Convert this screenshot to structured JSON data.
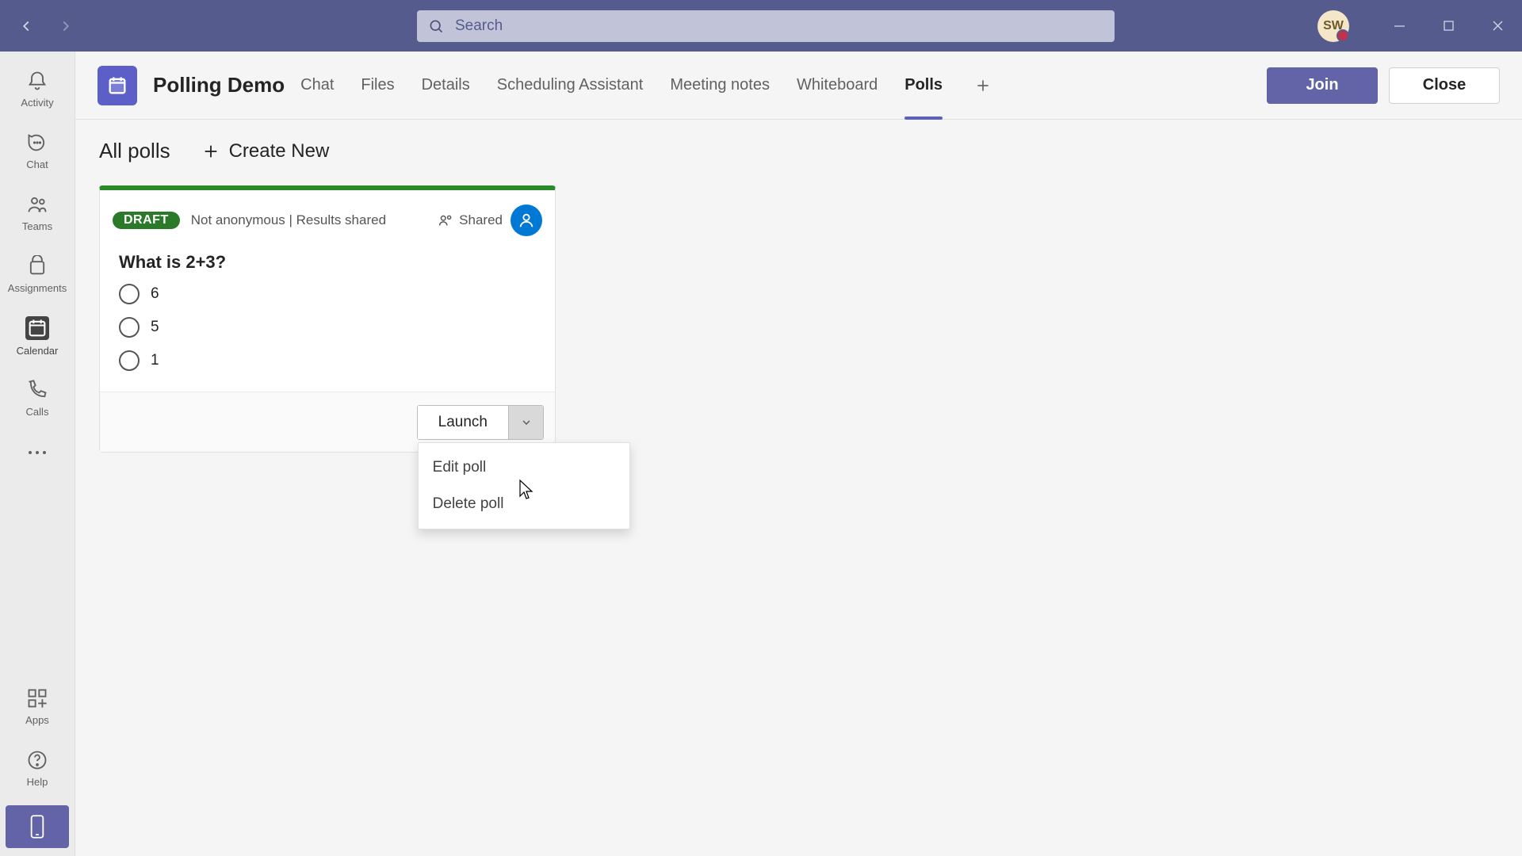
{
  "titlebar": {
    "search_placeholder": "Search",
    "avatar_initials": "SW"
  },
  "rail": {
    "items": [
      {
        "label": "Activity"
      },
      {
        "label": "Chat"
      },
      {
        "label": "Teams"
      },
      {
        "label": "Assignments"
      },
      {
        "label": "Calendar"
      },
      {
        "label": "Calls"
      }
    ],
    "apps_label": "Apps",
    "help_label": "Help"
  },
  "meeting": {
    "title": "Polling Demo",
    "tabs": [
      "Chat",
      "Files",
      "Details",
      "Scheduling Assistant",
      "Meeting notes",
      "Whiteboard",
      "Polls"
    ],
    "active_tab": "Polls",
    "join_label": "Join",
    "close_label": "Close"
  },
  "polls": {
    "header_title": "All polls",
    "create_label": "Create New",
    "card": {
      "badge": "DRAFT",
      "meta": "Not anonymous | Results shared",
      "shared_label": "Shared",
      "question": "What is 2+3?",
      "options": [
        "6",
        "5",
        "1"
      ],
      "launch_label": "Launch",
      "menu": {
        "edit": "Edit poll",
        "delete": "Delete poll"
      }
    }
  }
}
